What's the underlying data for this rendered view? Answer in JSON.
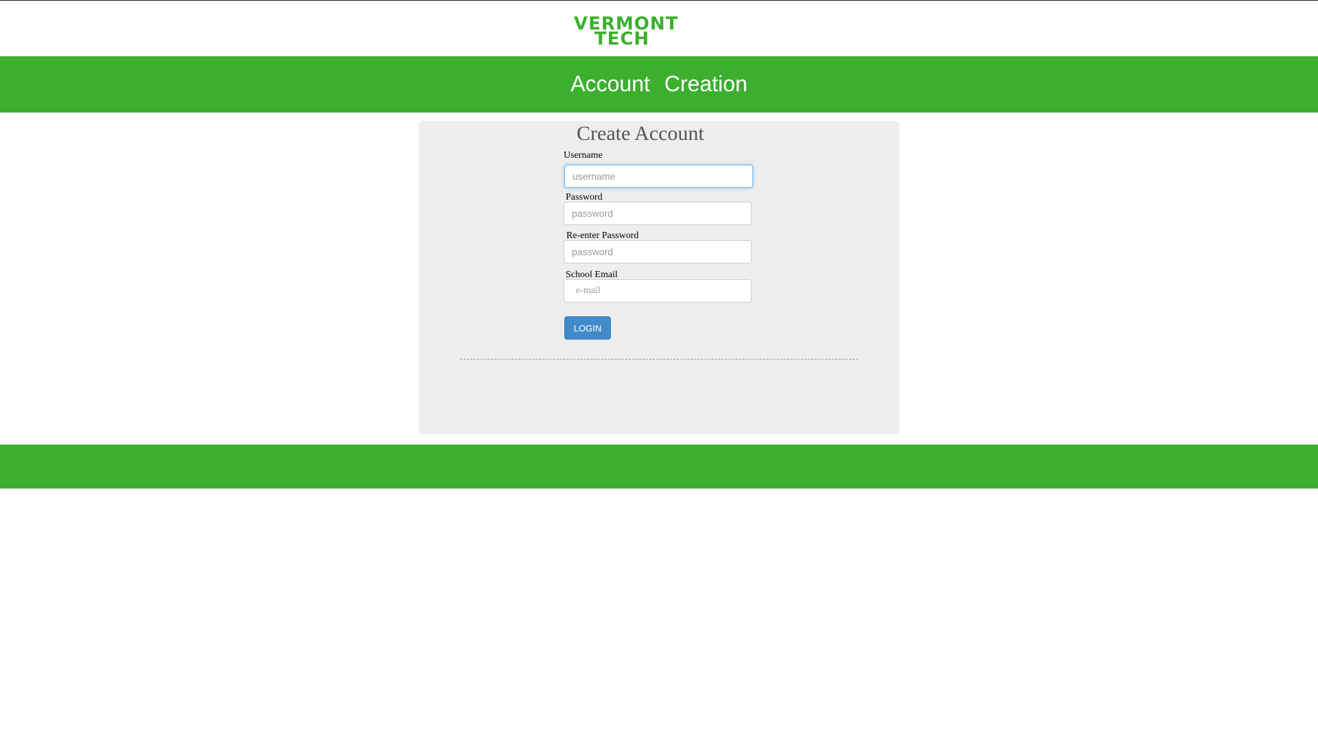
{
  "logo": {
    "line1": "VERMONT",
    "line2": "TECH",
    "color": "#3cb02e"
  },
  "header": {
    "title": "Account Creation",
    "background": "#3cb02e"
  },
  "form": {
    "title": "Create Account",
    "fields": [
      {
        "label": "Username",
        "placeholder": "username",
        "focused": true
      },
      {
        "label": "Password",
        "placeholder": "password"
      },
      {
        "label": "Re-enter Password",
        "placeholder": "password"
      },
      {
        "label": "School Email",
        "placeholder": "e-mail"
      }
    ],
    "submit_label": "LOGIN",
    "submit_color": "#428bca"
  },
  "footer": {
    "background": "#3cb02e"
  }
}
